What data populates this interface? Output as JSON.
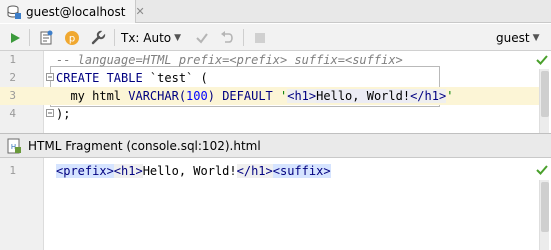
{
  "tab": {
    "title": "guest@localhost",
    "close_glyph": "✕",
    "icon": "database-console-icon"
  },
  "toolbar": {
    "run_icon": "run-icon",
    "history_icon": "history-icon",
    "parameters_icon": "parameters-icon",
    "settings_icon": "wrench-icon",
    "tx_mode": "Tx: Auto",
    "commit_icon": "commit-check-icon",
    "rollback_icon": "rollback-icon",
    "stop_icon": "stop-icon",
    "schema": "guest"
  },
  "editor": {
    "line_numbers": [
      "1",
      "2",
      "3",
      "4"
    ],
    "line1": "-- language=HTML prefix=<prefix> suffix=<suffix>",
    "line2_kw": "CREATE TABLE",
    "line2_rest": " `test` (",
    "line3_col": "  my html ",
    "line3_type": "VARCHAR(",
    "line3_num": "100",
    "line3_type_close": ")",
    "line3_default": " DEFAULT ",
    "line3_quote_open": "'",
    "line3_tag_open": "<h1>",
    "line3_text": "Hello, World!",
    "line3_tag_close": "</h1>",
    "line3_quote_close": "'",
    "line4": ");",
    "status_icon": "checkmark-icon"
  },
  "fragment": {
    "title": "HTML Fragment (console.sql:102).html",
    "icon": "html-file-icon",
    "line_numbers": [
      "1"
    ],
    "prefix": "<prefix>",
    "tag_open": "<h1>",
    "text": "Hello, World!",
    "tag_close": "</h1>",
    "suffix": "<suffix>",
    "status_icon": "checkmark-icon"
  },
  "colors": {
    "keyword": "#000080",
    "string": "#008000",
    "number": "#0000ff",
    "comment": "#808080",
    "caret_row": "#fcf5d6",
    "run_green": "#3c9a3c",
    "check_green": "#4aa02c"
  }
}
